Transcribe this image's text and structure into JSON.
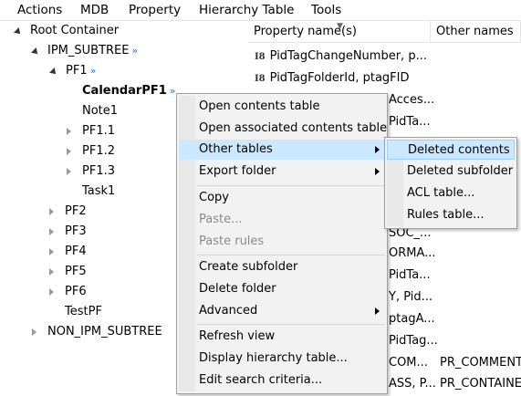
{
  "menubar": [
    "Actions",
    "MDB",
    "Property",
    "Hierarchy Table",
    "Tools"
  ],
  "tree": {
    "root": "Root Container",
    "ipm_subtree": "IPM_SUBTREE",
    "pf1": "PF1",
    "calendar": "CalendarPF1",
    "note1": "Note1",
    "pf1_1": "PF1.1",
    "pf1_2": "PF1.2",
    "pf1_3": "PF1.3",
    "task1": "Task1",
    "pf2": "PF2",
    "pf3": "PF3",
    "pf4": "PF4",
    "pf5": "PF5",
    "pf6": "PF6",
    "testpf": "TestPF",
    "non_ipm": "NON_IPM_SUBTREE",
    "more_glyph": "»"
  },
  "columns": {
    "property_name": "Property name(s)",
    "other_names": "Other names"
  },
  "rows": {
    "r1": "PidTagChangeNumber, p...",
    "r2": "PidTagFolderId, ptagFID",
    "r3": "Acces...",
    "r4": "PidTa...",
    "r5": "SOC_...",
    "r6": "ORMA...",
    "r7": "PidTa...",
    "r8": "Y, Pid...",
    "r9": "ptagA...",
    "r10": "PidTag...",
    "r11a": "COM...",
    "r11b": "PR_COMMENT",
    "r12a": "ASS, P...",
    "r12b": "PR_CONTAINE",
    "type_badge": "I8"
  },
  "context_menu": {
    "open_contents": "Open contents table",
    "open_assoc": "Open associated contents table",
    "other_tables": "Other tables",
    "export_folder": "Export folder",
    "copy": "Copy",
    "paste": "Paste...",
    "paste_rules": "Paste rules",
    "create_subfolder": "Create subfolder",
    "delete_folder": "Delete folder",
    "advanced": "Advanced",
    "refresh": "Refresh view",
    "display_hier": "Display hierarchy table...",
    "edit_search": "Edit search criteria..."
  },
  "submenu": {
    "deleted_contents": "Deleted contents",
    "deleted_subfolder": "Deleted subfolder",
    "acl": "ACL table...",
    "rules": "Rules table..."
  },
  "colors": {
    "highlight": "#cce8ff",
    "menu_bg": "#f2f2f2",
    "link_arrow": "#1f6fd0"
  }
}
